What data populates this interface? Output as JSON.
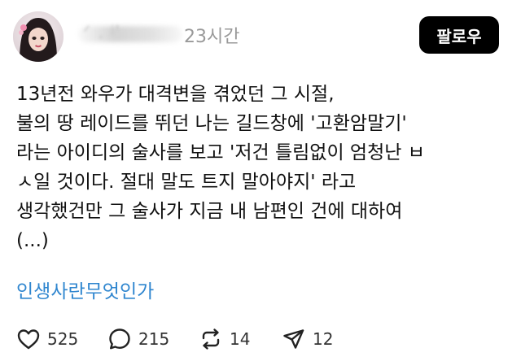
{
  "header": {
    "username_visible": "ᐟ . ʲ'",
    "time": "23시간",
    "follow_label": "팔로우"
  },
  "post": {
    "lines": [
      "13년전 와우가 대격변을 겪었던 그 시절,",
      "불의 땅 레이드를 뛰던 나는 길드창에 '고환암말기'",
      "라는 아이디의 술사를 보고 '저건 틀림없이 엄청난 ㅂ",
      "ㅅ일 것이다. 절대 말도 트지 말아야지' 라고",
      "생각했건만 그 술사가 지금 내 남편인 건에 대하여",
      "(...)"
    ],
    "hashtag": "인생사란무엇인가"
  },
  "actions": {
    "likes": "525",
    "comments": "215",
    "reposts": "14",
    "shares": "12"
  },
  "colors": {
    "hashtag": "#2f86cf",
    "follow_bg": "#000000",
    "time": "#999999"
  },
  "icons": [
    "heart-icon",
    "comment-icon",
    "repost-icon",
    "share-icon"
  ]
}
